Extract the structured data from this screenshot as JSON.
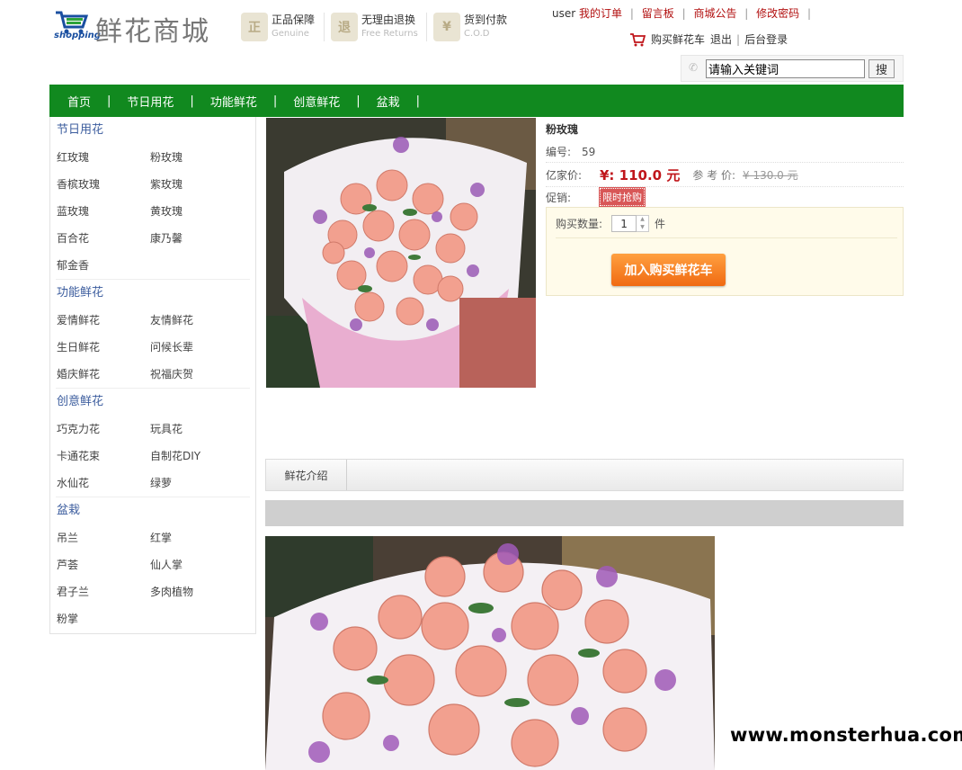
{
  "header": {
    "logo_text": "shopping",
    "brand": "鲜花商城",
    "guarantees": [
      {
        "cn": "正品保障",
        "en": "Genuine",
        "icon": "shield-icon"
      },
      {
        "cn": "无理由退换",
        "en": "Free Returns",
        "icon": "return-icon"
      },
      {
        "cn": "货到付款",
        "en": "C.O.D",
        "icon": "cod-icon"
      }
    ],
    "top_links": {
      "user": "user",
      "orders": "我的订单",
      "message": "留言板",
      "notice": "商城公告",
      "password": "修改密码"
    },
    "cart_row": {
      "cart": "购买鲜花车",
      "logout": "退出",
      "admin": "后台登录"
    },
    "search": {
      "value": "请输入关键词",
      "button": "搜"
    }
  },
  "nav": [
    "首页",
    "节日用花",
    "功能鲜花",
    "创意鲜花",
    "盆栽"
  ],
  "sidebar": [
    {
      "title": "节日用花",
      "items": [
        "红玫瑰",
        "粉玫瑰",
        "香槟玫瑰",
        "紫玫瑰",
        "蓝玫瑰",
        "黄玫瑰",
        "百合花",
        "康乃馨",
        "郁金香"
      ]
    },
    {
      "title": "功能鲜花",
      "items": [
        "爱情鲜花",
        "友情鲜花",
        "生日鲜花",
        "问候长辈",
        "婚庆鲜花",
        "祝福庆贺"
      ]
    },
    {
      "title": "创意鲜花",
      "items": [
        "巧克力花",
        "玩具花",
        "卡通花束",
        "自制花DIY",
        "水仙花",
        "绿萝"
      ]
    },
    {
      "title": "盆栽",
      "items": [
        "吊兰",
        "红掌",
        "芦荟",
        "仙人掌",
        "君子兰",
        "多肉植物",
        "粉掌"
      ]
    }
  ],
  "product": {
    "name": "粉玫瑰",
    "id_label": "编号:",
    "id": "59",
    "price_label": "亿家价:",
    "price": "¥: 110.0 元",
    "ref_label": "参 考 价:",
    "ref_price": "¥ 130.0 元",
    "promo_label": "促销:",
    "promo_tag": "限时抢购",
    "qty_label": "购买数量:",
    "qty": "1",
    "unit": "件",
    "add_button": "加入购买鲜花车"
  },
  "tabs": {
    "intro": "鲜花介绍"
  },
  "watermark": "www.monsterhua.com"
}
